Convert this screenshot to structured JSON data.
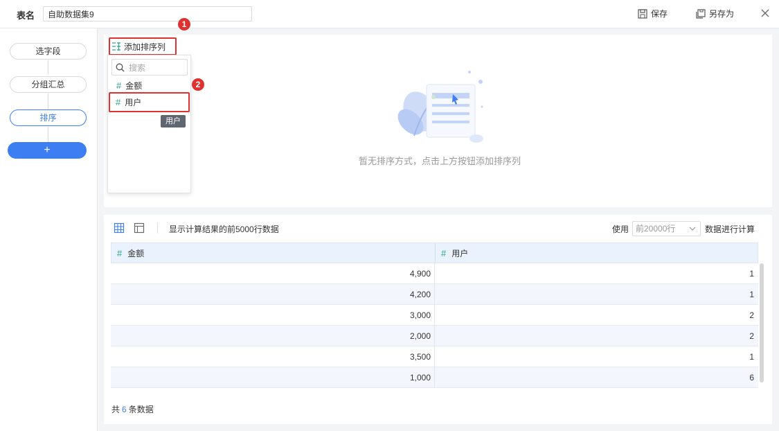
{
  "topbar": {
    "table_name_label": "表名",
    "table_name_value": "自助数据集9",
    "save_label": "保存",
    "save_as_label": "另存为"
  },
  "sidebar": {
    "steps": [
      {
        "label": "选字段"
      },
      {
        "label": "分组汇总"
      },
      {
        "label": "排序",
        "active": true
      },
      {
        "label": "+"
      }
    ]
  },
  "sort_panel": {
    "add_sort_label": "添加排序列",
    "badge_1": "1",
    "badge_2": "2",
    "dropdown": {
      "search_placeholder": "搜索",
      "items": [
        {
          "label": "金额",
          "icon": "hash-icon"
        },
        {
          "label": "用户",
          "icon": "hash-icon",
          "hovered": true
        }
      ],
      "tooltip": "用户"
    },
    "empty_message": "暂无排序方式，点击上方按钮添加排序列"
  },
  "result_panel": {
    "info": "显示计算结果的前5000行数据",
    "use_label": "使用",
    "row_limit_value": "前20000行",
    "calc_label": "数据进行计算",
    "columns": [
      {
        "label": "金额",
        "type": "number"
      },
      {
        "label": "用户",
        "type": "number"
      }
    ],
    "rows": [
      {
        "amount": "4,900",
        "user": "1"
      },
      {
        "amount": "4,200",
        "user": "1"
      },
      {
        "amount": "3,000",
        "user": "2"
      },
      {
        "amount": "2,000",
        "user": "2"
      },
      {
        "amount": "3,500",
        "user": "1"
      },
      {
        "amount": "1,000",
        "user": "6"
      }
    ],
    "footer_prefix": "共",
    "footer_count": "6",
    "footer_suffix": "条数据"
  },
  "colors": {
    "accent": "#3d7ff2",
    "highlight": "#e03131",
    "number_type": "#2ba38f",
    "header_bg": "#eaf2fd"
  }
}
